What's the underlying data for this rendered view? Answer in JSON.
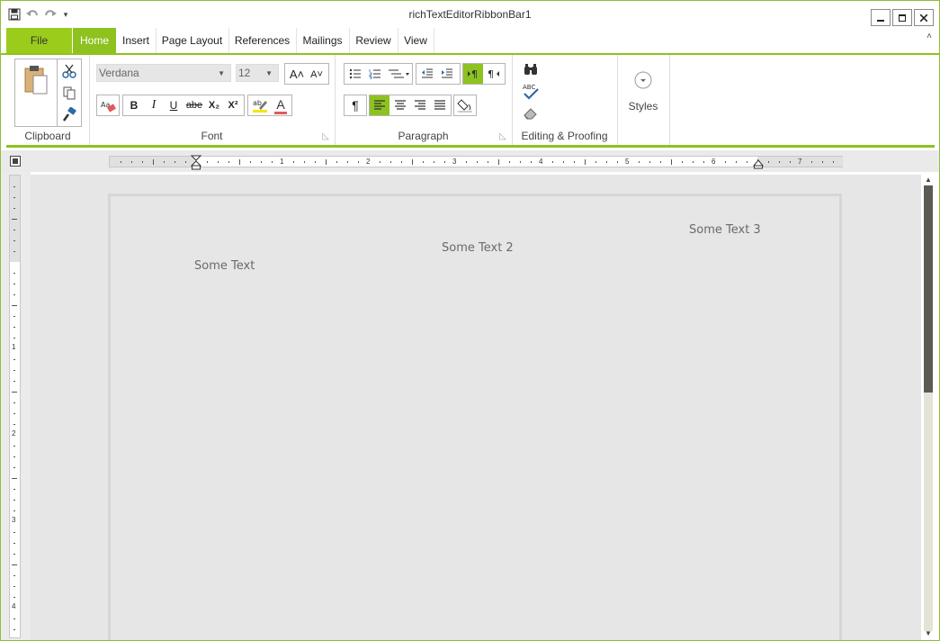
{
  "window": {
    "title": "richTextEditorRibbonBar1",
    "controls": {
      "minimize": "—",
      "maximize": "□",
      "close": "✕"
    }
  },
  "quick_access": {
    "icons": [
      "save-icon",
      "undo-icon",
      "redo-icon"
    ],
    "more": "▾"
  },
  "tabs": {
    "file": "File",
    "items": [
      {
        "label": "Home",
        "active": true
      },
      {
        "label": "Insert",
        "active": false
      },
      {
        "label": "Page Layout",
        "active": false
      },
      {
        "label": "References",
        "active": false
      },
      {
        "label": "Mailings",
        "active": false
      },
      {
        "label": "Review",
        "active": false
      },
      {
        "label": "View",
        "active": false
      }
    ],
    "collapse": "˄"
  },
  "ribbon": {
    "clipboard": {
      "label": "Clipboard"
    },
    "font": {
      "label": "Font",
      "font_name": "Verdana",
      "font_size": "12",
      "grow": "A˄",
      "shrink": "A˅",
      "bold": "B",
      "italic": "I",
      "underline": "U",
      "strike": "abe",
      "subscript": "X₂",
      "superscript": "X²",
      "font_color": "A"
    },
    "paragraph": {
      "label": "Paragraph",
      "pilcrow": "¶"
    },
    "editing": {
      "label": "Editing & Proofing",
      "spell": "ABC"
    },
    "styles": {
      "label": "Styles",
      "icon": "▾"
    }
  },
  "ruler": {
    "h_numbers": [
      "1",
      "2",
      "3",
      "4",
      "5",
      "6",
      "7"
    ],
    "v_numbers": [
      "1",
      "2",
      "3",
      "4"
    ]
  },
  "document": {
    "texts": [
      "Some Text",
      "Some Text 2",
      "Some Text 3"
    ]
  },
  "scrollbar": {
    "up": "▲",
    "down": "▼"
  },
  "colors": {
    "accent": "#8dc21f",
    "file_tab": "#9bcc1c",
    "page": "#e6e6e6"
  }
}
